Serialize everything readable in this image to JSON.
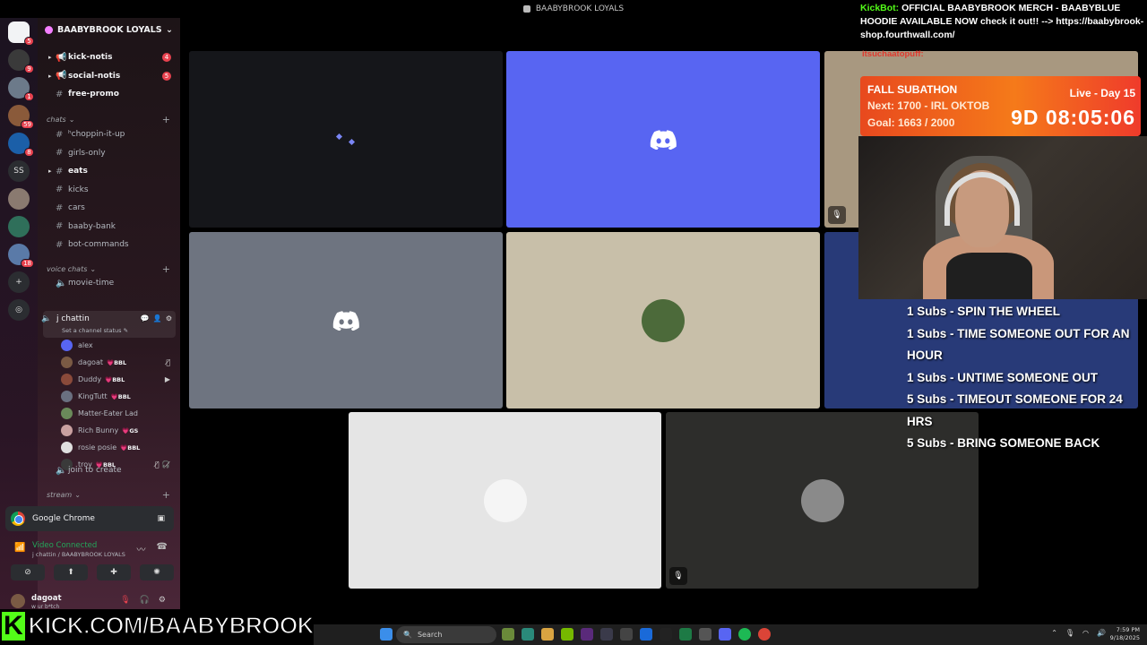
{
  "window_title": "BAABYBROOK LOYALS",
  "rail": {
    "servers": [
      {
        "badge": "5",
        "color": "#f2f3f5",
        "home": true,
        "label": ""
      },
      {
        "badge": "9",
        "color": "#3a3a3a",
        "label": ""
      },
      {
        "badge": "1",
        "color": "#6c7a8a",
        "label": ""
      },
      {
        "badge": "59",
        "color": "#8a5a3a",
        "label": ""
      },
      {
        "badge": "8",
        "color": "#1b5fa8",
        "label": ""
      },
      {
        "badge": "",
        "color": "#2b2d31",
        "label": "SS"
      },
      {
        "badge": "",
        "color": "#8a7a70",
        "label": ""
      },
      {
        "badge": "",
        "color": "#2f6f5a",
        "label": ""
      },
      {
        "badge": "18",
        "color": "#5a7aa8",
        "label": ""
      },
      {
        "badge": "",
        "color": "#2b2d31",
        "label": "+"
      },
      {
        "badge": "",
        "color": "#2b2d31",
        "label": "◎"
      }
    ]
  },
  "sidebar": {
    "guild_name": "BAABYBROOK LOYALS",
    "channels_top": [
      {
        "label": "kick-notis",
        "count": "4",
        "icon": "📢",
        "arrow": "▸",
        "bold": true
      },
      {
        "label": "social-notis",
        "count": "5",
        "icon": "📢",
        "arrow": "▸",
        "bold": true
      },
      {
        "label": "free-promo",
        "count": "",
        "icon": "#",
        "arrow": "",
        "bold": true
      }
    ],
    "cat_chats": "chats",
    "chat_channels": [
      {
        "label": "ʰchoppin-it-up",
        "arrow": "",
        "bold": false
      },
      {
        "label": "girls-only",
        "arrow": "",
        "bold": false
      },
      {
        "label": "eats",
        "arrow": "▸",
        "bold": true
      },
      {
        "label": "kicks",
        "arrow": "",
        "bold": false
      },
      {
        "label": "cars",
        "arrow": "",
        "bold": false
      },
      {
        "label": "baaby-bank",
        "arrow": "",
        "bold": false
      },
      {
        "label": "bot-commands",
        "arrow": "",
        "bold": false
      }
    ],
    "cat_voice": "voice chats",
    "movie_time": "movie-time",
    "active_voice": {
      "name": "j chattin",
      "status": "Set a channel status ✎"
    },
    "voice_users": [
      {
        "name": "alex",
        "tag": "",
        "color": "#5865f2",
        "icon": ""
      },
      {
        "name": "dagoat",
        "tag": "BBL",
        "color": "#7a5a44",
        "icon": "🎙̸"
      },
      {
        "name": "Duddy",
        "tag": "BBL",
        "color": "#8a4a3a",
        "icon": "▶"
      },
      {
        "name": "KingTutt",
        "tag": "BBL",
        "color": "#6a7080",
        "icon": ""
      },
      {
        "name": "Matter-Eater Lad",
        "tag": "",
        "color": "#6a8a5a",
        "icon": ""
      },
      {
        "name": "Rich Bunny",
        "tag": "GS",
        "color": "#c9a0a0",
        "icon": ""
      },
      {
        "name": "rosie posie",
        "tag": "BBL",
        "color": "#e0e0e0",
        "icon": ""
      },
      {
        "name": "troy",
        "tag": "BBL",
        "color": "#3a3a3a",
        "icon": "🎙̸ 🎧̸"
      }
    ],
    "join_to_create": "join to create",
    "cat_stream": "stream"
  },
  "app_card": {
    "label": "Google Chrome"
  },
  "voice_connection": {
    "title": "Video Connected",
    "subtitle": "j chattin / BAABYBROOK LOYALS"
  },
  "user_panel": {
    "name": "dagoat",
    "status": "w ur b*tch"
  },
  "tiles": [
    {
      "kind": "loading",
      "bg": "#15161a"
    },
    {
      "kind": "discord",
      "bg": "#5865f2"
    },
    {
      "kind": "muted",
      "bg": "#a89880"
    },
    {
      "kind": "discord",
      "bg": "#6e7480"
    },
    {
      "kind": "avatar",
      "bg": "#c8bfa9",
      "avatar": "#4c6a3a"
    },
    {
      "kind": "stream",
      "bg": "#283a78"
    },
    {
      "kind": "avatar",
      "bg": "#e5e5e5",
      "avatar": "#f5f5f5"
    },
    {
      "kind": "avatar",
      "bg": "#2d2d2b",
      "avatar": "#8a8a8a",
      "muted": true
    }
  ],
  "overlay": {
    "bot_name": "KickBot:",
    "bot_message": "OFFICIAL BAABYBROOK MERCH - BAABYBLUE HOODIE AVAILABLE NOW check it out!! --> https://baabybrook-shop.fourthwall.com/",
    "chat_user2": "itsuchaatopuff:",
    "subathon": {
      "title": "FALL SUBATHON",
      "next": "Next: 1700 - IRL OKTOB",
      "goal": "Goal: 1663 / 2000",
      "live": "Live - Day 15",
      "timer": "9D 08:05:06"
    },
    "rules": [
      "1 Subs - SPIN THE WHEEL",
      "1 Subs - TIME SOMEONE OUT FOR AN HOUR",
      "1 Subs - UNTIME SOMEONE OUT",
      "5 Subs - TIMEOUT SOMEONE FOR 24 HRS",
      "5 Subs - BRING SOMEONE BACK"
    ],
    "kick_letter": "K",
    "kick_url": "KICK.COM/BAABYBROOK"
  },
  "taskbar": {
    "search_label": "Search",
    "time": "7:59 PM",
    "date": "9/18/2025"
  }
}
